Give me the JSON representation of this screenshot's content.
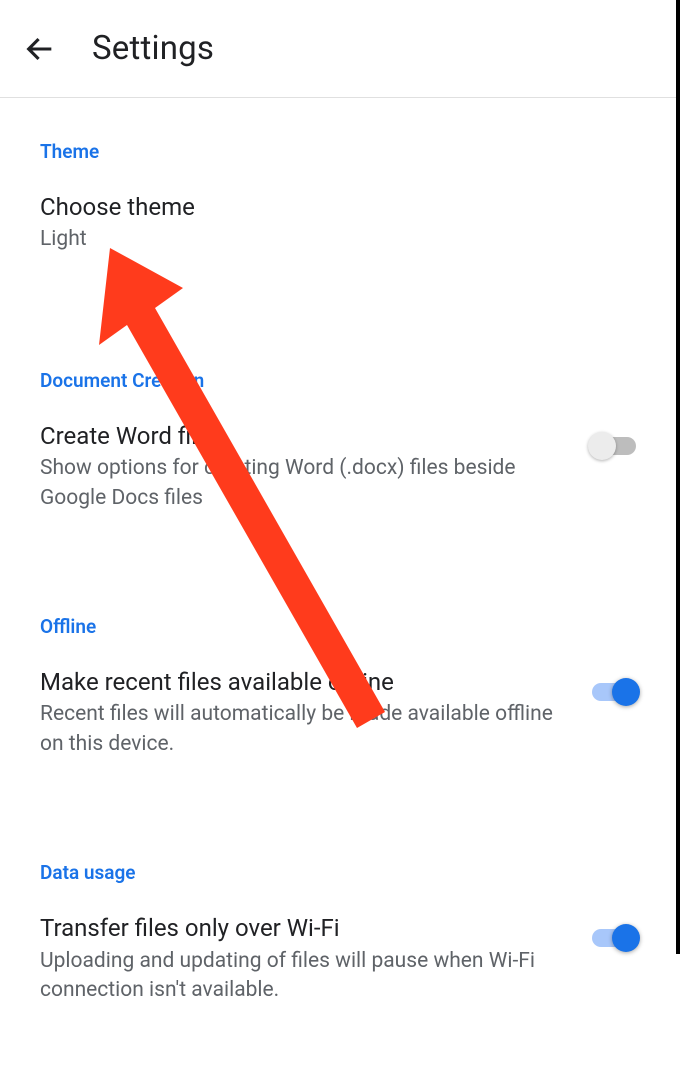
{
  "header": {
    "title": "Settings"
  },
  "sections": {
    "theme": {
      "header": "Theme",
      "choose_theme": {
        "title": "Choose theme",
        "value": "Light"
      }
    },
    "document_creation": {
      "header": "Document Creation",
      "create_word": {
        "title": "Create Word files",
        "desc": "Show options for creating Word (.docx) files beside Google Docs files",
        "enabled": false
      }
    },
    "offline": {
      "header": "Offline",
      "make_offline": {
        "title": "Make recent files available offline",
        "desc": "Recent files will automatically be made available offline on this device.",
        "enabled": true
      }
    },
    "data_usage": {
      "header": "Data usage",
      "wifi_only": {
        "title": "Transfer files only over Wi-Fi",
        "desc": "Uploading and updating of files will pause when Wi-Fi connection isn't available.",
        "enabled": true
      }
    }
  },
  "annotation": {
    "arrow_color": "#ff3b1f"
  }
}
